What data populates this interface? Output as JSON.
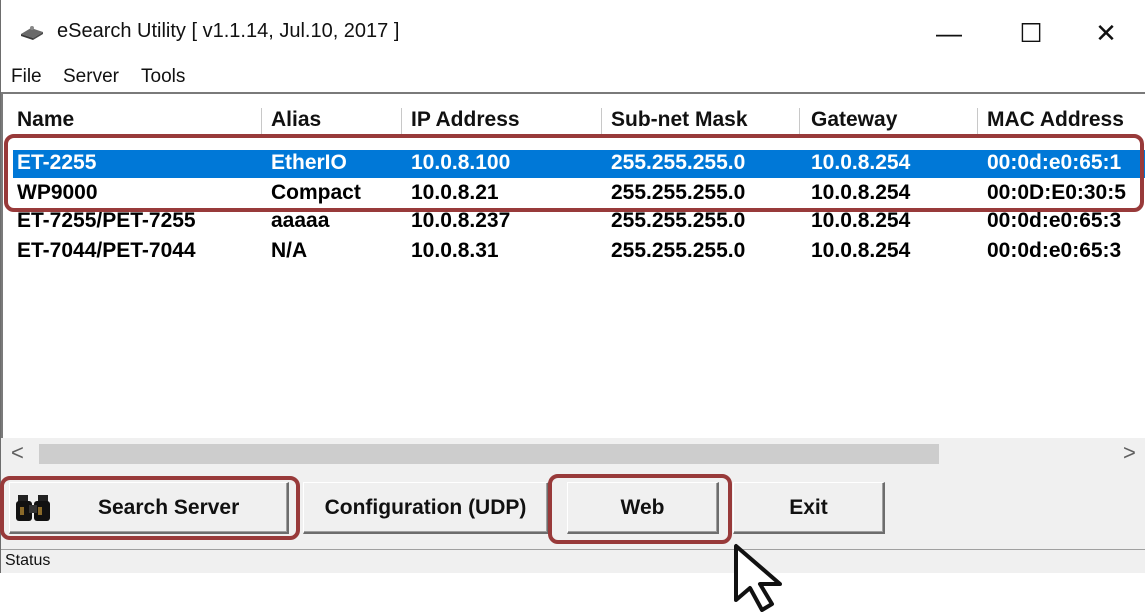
{
  "window": {
    "title": "eSearch Utility [ v1.1.14, Jul.10, 2017 ]",
    "min_glyph": "—",
    "max_glyph": "☐",
    "close_glyph": "✕"
  },
  "menu": [
    "File",
    "Server",
    "Tools"
  ],
  "columns": [
    "Name",
    "Alias",
    "IP Address",
    "Sub-net Mask",
    "Gateway",
    "MAC Address"
  ],
  "rows": [
    {
      "name": "ET-2255",
      "alias": "EtherIO",
      "ip": "10.0.8.100",
      "mask": "255.255.255.0",
      "gateway": "10.0.8.254",
      "mac": "00:0d:e0:65:1",
      "selected": true
    },
    {
      "name": "WP9000",
      "alias": "Compact",
      "ip": "10.0.8.21",
      "mask": "255.255.255.0",
      "gateway": "10.0.8.254",
      "mac": "00:0D:E0:30:5",
      "selected": false
    },
    {
      "name": "ET-7255/PET-7255",
      "alias": "aaaaa",
      "ip": "10.0.8.237",
      "mask": "255.255.255.0",
      "gateway": "10.0.8.254",
      "mac": "00:0d:e0:65:3",
      "selected": false
    },
    {
      "name": "ET-7044/PET-7044",
      "alias": "N/A",
      "ip": "10.0.8.31",
      "mask": "255.255.255.0",
      "gateway": "10.0.8.254",
      "mac": "00:0d:e0:65:3",
      "selected": false
    }
  ],
  "scroll": {
    "left": "<",
    "right": ">"
  },
  "buttons": {
    "search": "Search Server",
    "config": "Configuration (UDP)",
    "web": "Web",
    "exit": "Exit"
  },
  "status": "Status",
  "colors": {
    "selection": "#0078d7",
    "highlight": "#983a3a",
    "panel": "#f0f0f0"
  },
  "icons": [
    "app-icon",
    "binoculars-icon",
    "mouse-cursor-icon"
  ]
}
